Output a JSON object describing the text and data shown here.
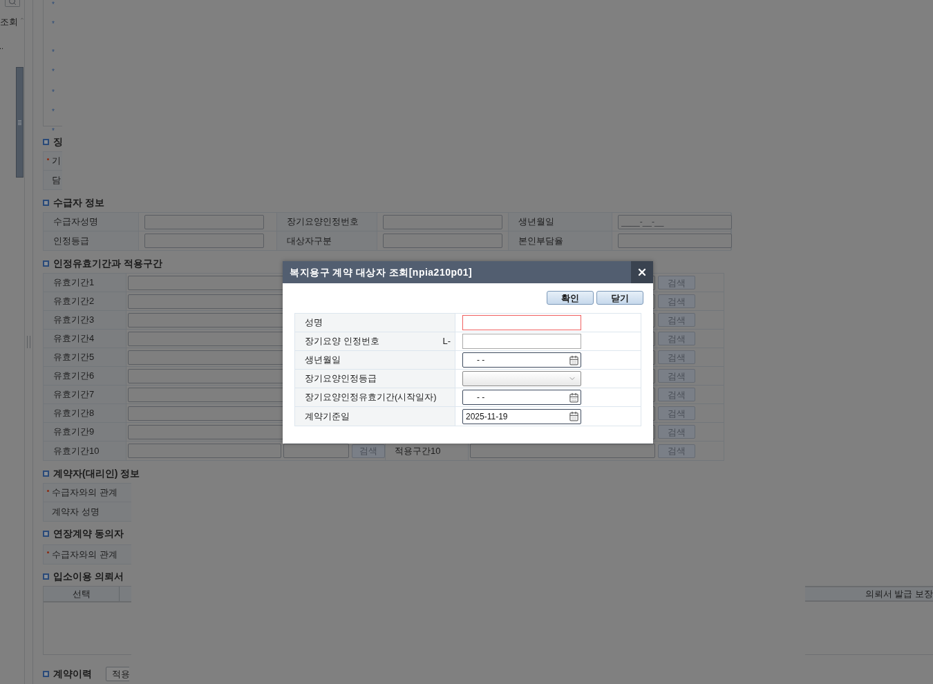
{
  "sidebar": {
    "label": "조회",
    "ellipsis": ".."
  },
  "notice_bullets": [
    "*",
    "*",
    "*",
    "*",
    "*",
    "*",
    "*"
  ],
  "section_cut": {
    "title": "징",
    "rows": [
      {
        "label": "기",
        "required": true
      },
      {
        "label": "담",
        "required": false
      }
    ]
  },
  "recipient": {
    "title": "수급자 정보",
    "fields": [
      {
        "label": "수급자성명"
      },
      {
        "label": "장기요양인정번호"
      },
      {
        "label": "생년월일",
        "placeholder": "____-__-__"
      },
      {
        "label": "인정등급"
      },
      {
        "label": "대상자구분"
      },
      {
        "label": "본인부담율"
      }
    ]
  },
  "periods": {
    "title": "인정유효기간과 적용구간",
    "rows": [
      {
        "label": "유효기간1",
        "button": "검색"
      },
      {
        "label": "유효기간2",
        "button": "검색"
      },
      {
        "label": "유효기간3",
        "button": "검색"
      },
      {
        "label": "유효기간4",
        "button": "검색"
      },
      {
        "label": "유효기간5",
        "button": "검색"
      },
      {
        "label": "유효기간6",
        "button": "검색"
      },
      {
        "label": "유효기간7",
        "button": "검색"
      },
      {
        "label": "유효기간8",
        "button": "검색"
      },
      {
        "label": "유효기간9",
        "button": "검색"
      },
      {
        "label": "유효기간10",
        "left_button": "검색",
        "apply_label": "적용구간10",
        "button": "검색"
      }
    ]
  },
  "contractor": {
    "title": "계약자(대리인) 정보",
    "rows": [
      {
        "label": "수급자와의 관계",
        "required": true
      },
      {
        "label": "계약자 성명",
        "required": false
      }
    ]
  },
  "extension": {
    "title": "연장계약 동의자",
    "rows": [
      {
        "label": "수급자와의 관계",
        "required": true
      }
    ]
  },
  "admission": {
    "title": "입소이용 의뢰서",
    "columns": [
      "선택"
    ],
    "right_header": "의뢰서 발급 보장"
  },
  "history": {
    "title": "계약이력",
    "button": "적용"
  },
  "dialog": {
    "title": "복지용구 계약 대상자 조회[npia210p01]",
    "buttons": [
      "확인",
      "닫기"
    ],
    "fields": [
      {
        "label": "성명",
        "kind": "text",
        "invalid": true
      },
      {
        "label": "장기요양 인정번호",
        "prefix": "L-",
        "kind": "text",
        "invalid": false
      },
      {
        "label": "생년월일",
        "kind": "date",
        "value": "- -",
        "invalid": false
      },
      {
        "label": "장기요양인정등급",
        "kind": "select",
        "invalid": false
      },
      {
        "label": "장기요양인정유효기간(시작일자)",
        "kind": "date",
        "value": "- -",
        "invalid": false
      },
      {
        "label": "계약기준일",
        "kind": "date",
        "value": "2025-11-19",
        "invalid": false
      }
    ]
  }
}
